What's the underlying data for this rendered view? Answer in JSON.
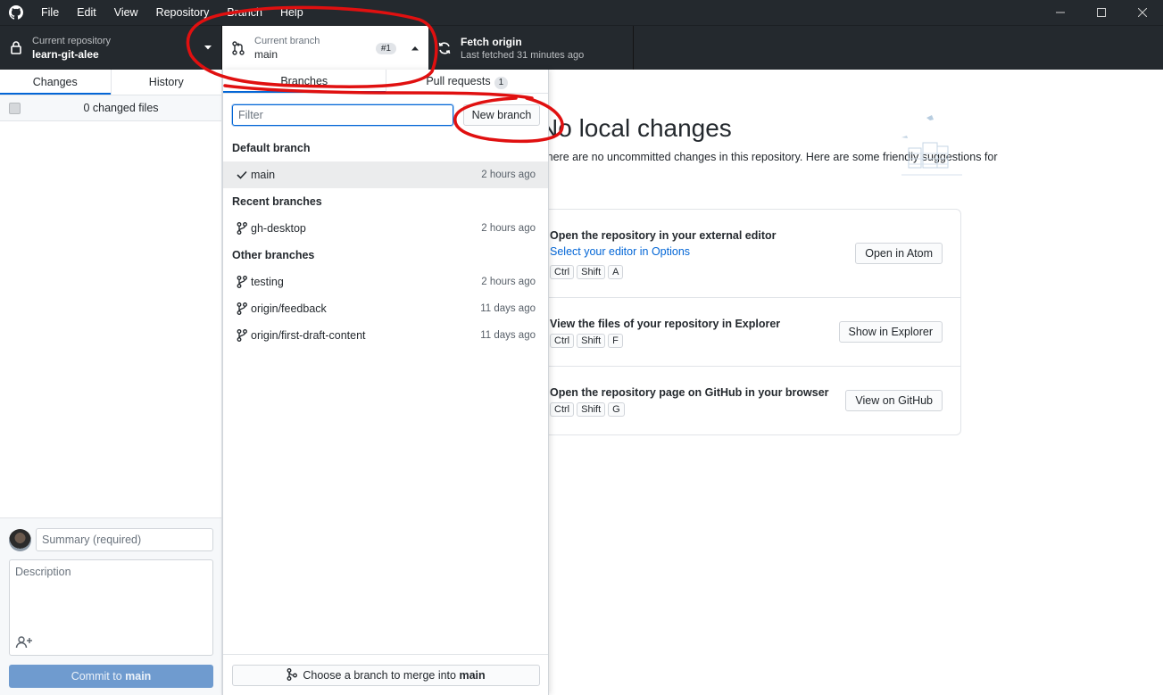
{
  "menu": {
    "items": [
      "File",
      "Edit",
      "View",
      "Repository",
      "Branch",
      "Help"
    ]
  },
  "toolbar": {
    "repo": {
      "description": "Current repository",
      "title": "learn-git-alee"
    },
    "branch": {
      "description": "Current branch",
      "title": "main",
      "pr_badge": "#1"
    },
    "fetch": {
      "title": "Fetch origin",
      "description": "Last fetched 31 minutes ago"
    }
  },
  "sidebar": {
    "tabs": [
      "Changes",
      "History"
    ],
    "changed_files": "0 changed files",
    "summary_placeholder": "Summary (required)",
    "description_placeholder": "Description",
    "commit_prefix": "Commit to ",
    "commit_branch": "main"
  },
  "main": {
    "heading": "No local changes",
    "subtext": "There are no uncommitted changes in this repository. Here are some friendly suggestions for",
    "suggestions": [
      {
        "title": "Open the repository in your external editor",
        "link": "Select your editor in Options",
        "keys": [
          "Ctrl",
          "Shift",
          "A"
        ],
        "button": "Open in Atom"
      },
      {
        "title": "View the files of your repository in Explorer",
        "keys": [
          "Ctrl",
          "Shift",
          "F"
        ],
        "button": "Show in Explorer"
      },
      {
        "title": "Open the repository page on GitHub in your browser",
        "keys": [
          "Ctrl",
          "Shift",
          "G"
        ],
        "button": "View on GitHub"
      }
    ]
  },
  "branch_dropdown": {
    "tabs": {
      "branches": "Branches",
      "pull_requests": "Pull requests",
      "pr_count": "1"
    },
    "filter_placeholder": "Filter",
    "new_branch": "New branch",
    "groups": {
      "default": "Default branch",
      "recent": "Recent branches",
      "other": "Other branches"
    },
    "branches": [
      {
        "name": "main",
        "time": "2 hours ago",
        "selected": true,
        "icon": "check-icon"
      },
      {
        "name": "gh-desktop",
        "time": "2 hours ago",
        "selected": false,
        "icon": "branch-icon"
      },
      {
        "name": "testing",
        "time": "2 hours ago",
        "selected": false,
        "icon": "branch-icon"
      },
      {
        "name": "origin/feedback",
        "time": "11 days ago",
        "selected": false,
        "icon": "branch-icon"
      },
      {
        "name": "origin/first-draft-content",
        "time": "11 days ago",
        "selected": false,
        "icon": "branch-icon"
      }
    ],
    "merge_prefix": "Choose a branch to merge into ",
    "merge_branch": "main"
  },
  "colors": {
    "accent": "#0366d6",
    "annotation": "#e01010",
    "toolbar_bg": "#24292e"
  }
}
